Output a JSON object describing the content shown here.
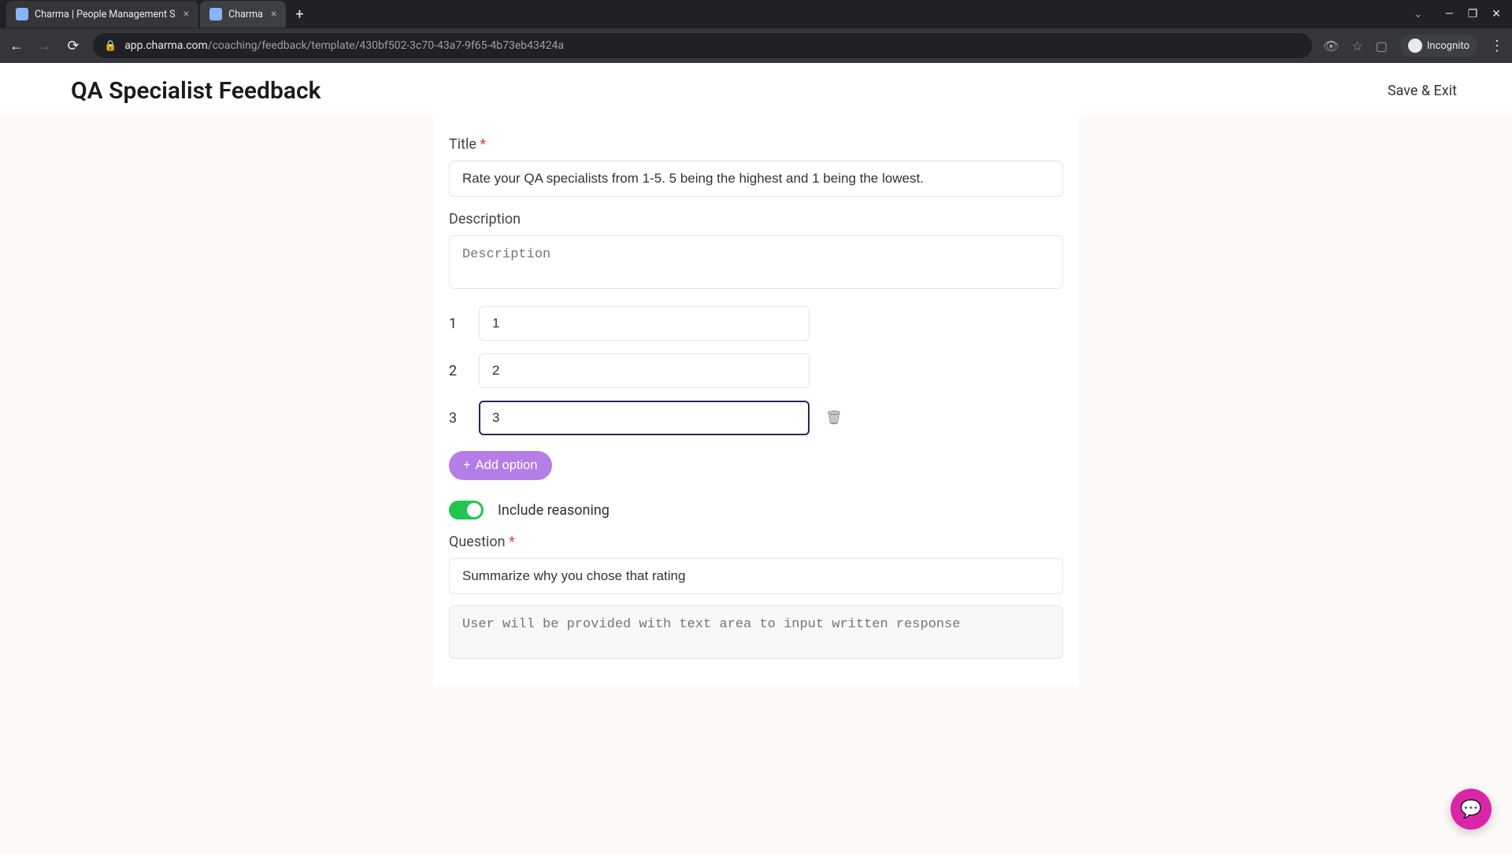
{
  "browser": {
    "tabs": [
      {
        "title": "Charma | People Management S",
        "active": false
      },
      {
        "title": "Charma",
        "active": true
      }
    ],
    "url_host": "app.charma.com",
    "url_path": "/coaching/feedback/template/430bf502-3c70-43a7-9f65-4b73eb43424a",
    "incognito_label": "Incognito"
  },
  "header": {
    "page_title": "QA Specialist Feedback",
    "save_exit": "Save & Exit"
  },
  "form": {
    "title_label": "Title",
    "title_value": "Rate your QA specialists from 1-5. 5 being the highest and 1 being the lowest.",
    "description_label": "Description",
    "description_placeholder": "Description",
    "options": [
      {
        "num": "1",
        "value": "1",
        "focused": false
      },
      {
        "num": "2",
        "value": "2",
        "focused": false
      },
      {
        "num": "3",
        "value": "3",
        "focused": true,
        "show_trash": true
      }
    ],
    "add_option_label": "Add option",
    "include_reasoning_label": "Include reasoning",
    "include_reasoning_on": true,
    "question_label": "Question",
    "question_value": "Summarize why you chose that rating",
    "response_placeholder": "User will be provided with text area to input written response"
  }
}
